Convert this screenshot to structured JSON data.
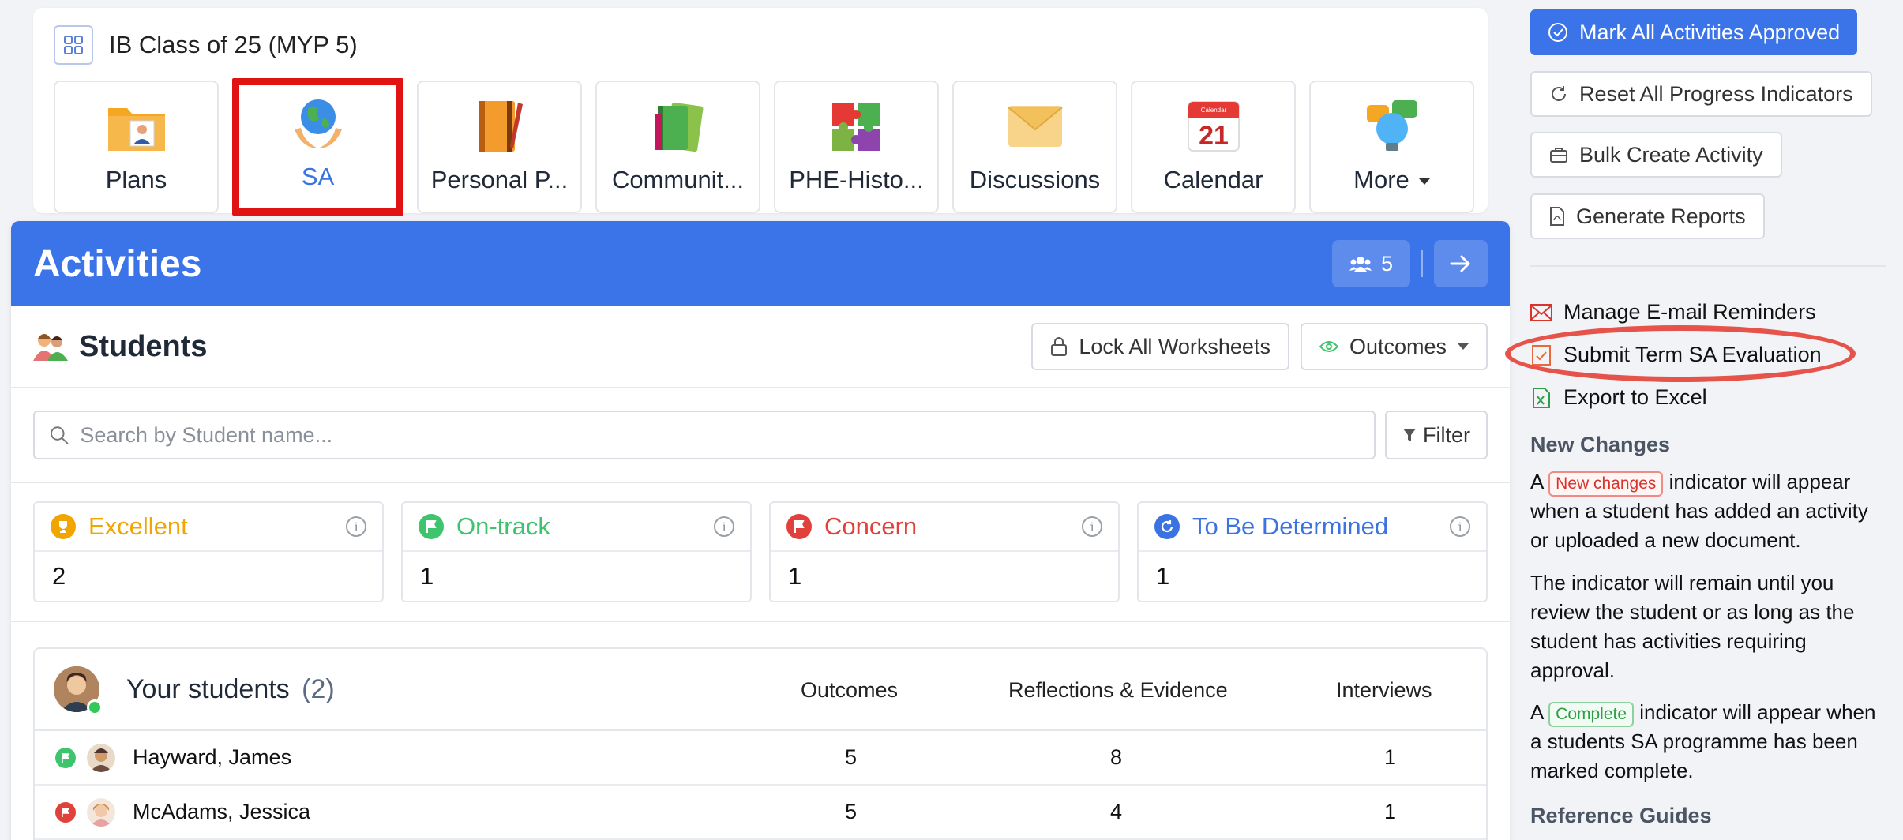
{
  "class": {
    "title": "IB Class of 25 (MYP 5)"
  },
  "apps": [
    {
      "label": "Plans",
      "icon": "folder-person-icon"
    },
    {
      "label": "SA",
      "icon": "globe-hands-icon"
    },
    {
      "label": "Personal P...",
      "icon": "notebook-pen-icon"
    },
    {
      "label": "Communit...",
      "icon": "books-icon"
    },
    {
      "label": "PHE-Histo...",
      "icon": "puzzle-icon"
    },
    {
      "label": "Discussions",
      "icon": "envelope-icon"
    },
    {
      "label": "Calendar",
      "icon": "calendar-icon",
      "calendar_day": "21",
      "calendar_caption": "Calendar"
    },
    {
      "label": "More",
      "icon": "lightbulb-chat-icon"
    }
  ],
  "activities": {
    "title": "Activities",
    "group_count": "5"
  },
  "students": {
    "title": "Students",
    "lock_label": "Lock All Worksheets",
    "outcomes_label": "Outcomes",
    "search_placeholder": "Search by Student name...",
    "filter_label": "Filter"
  },
  "status_cards": [
    {
      "label": "Excellent",
      "count": "2",
      "color": "#f0a500"
    },
    {
      "label": "On-track",
      "count": "1",
      "color": "#3ec46d"
    },
    {
      "label": "Concern",
      "count": "1",
      "color": "#e0413a"
    },
    {
      "label": "To Be Determined",
      "count": "1",
      "color": "#3b73e0"
    }
  ],
  "your_students": {
    "title": "Your students",
    "count": "(2)",
    "columns": [
      "Outcomes",
      "Reflections & Evidence",
      "Interviews"
    ],
    "rows": [
      {
        "name": "Hayward, James",
        "status_color": "#3ec46d",
        "outcomes": "5",
        "reflections": "8",
        "interviews": "1"
      },
      {
        "name": "McAdams, Jessica",
        "status_color": "#e0413a",
        "outcomes": "5",
        "reflections": "4",
        "interviews": "1"
      }
    ]
  },
  "sidebar": {
    "approve_label": "Mark All Activities Approved",
    "reset_label": "Reset All Progress Indicators",
    "bulk_label": "Bulk Create Activity",
    "reports_label": "Generate Reports",
    "links": [
      {
        "label": "Manage E-mail Reminders",
        "icon": "envelope-icon"
      },
      {
        "label": "Submit Term SA Evaluation",
        "icon": "checklist-icon"
      },
      {
        "label": "Export to Excel",
        "icon": "excel-file-icon"
      }
    ],
    "new_changes_heading": "New Changes",
    "p1_before": "A",
    "new_changes_tag": "New changes",
    "p1_after": "indicator will appear when a student has added an activity or uploaded a new document.",
    "p2": "The indicator will remain until you review the student or as long as the student has activities requiring approval.",
    "p3_before": "A",
    "complete_tag": "Complete",
    "p3_after": "indicator will appear when a students SA programme has been marked complete.",
    "reference_heading": "Reference Guides"
  },
  "colors": {
    "primary": "#3b73e8",
    "highlight": "#e01212"
  }
}
